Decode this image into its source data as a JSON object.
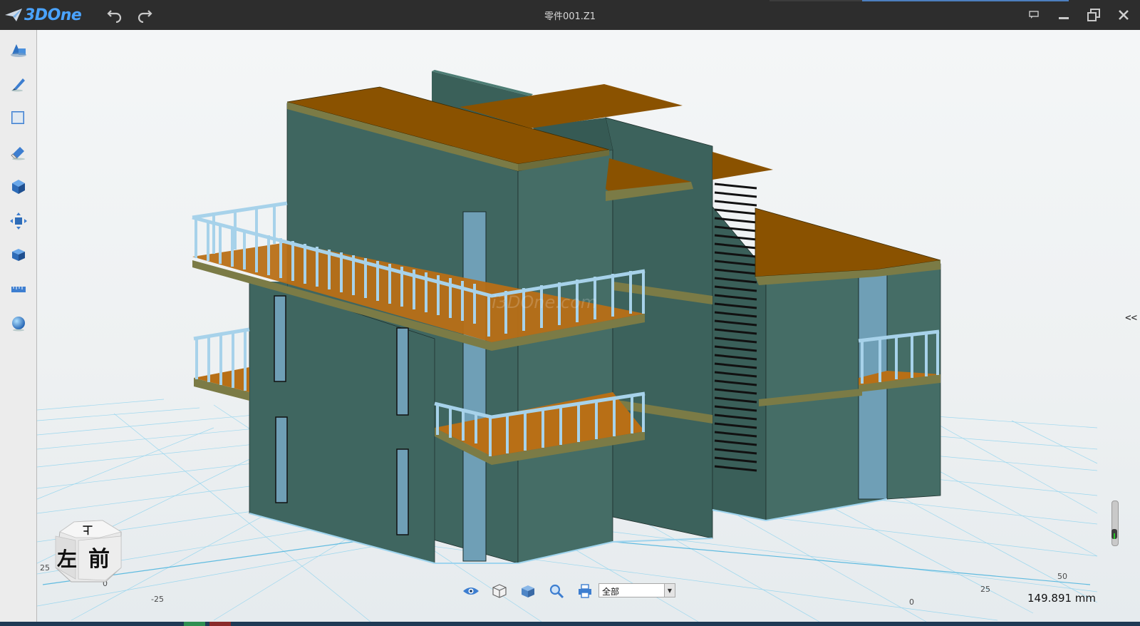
{
  "app": {
    "name": "3DOne",
    "document_title": "零件001.Z1",
    "brand_color": "#4aa3ff"
  },
  "title_bar": {
    "undo_icon": "undo-icon",
    "redo_icon": "redo-icon",
    "window_buttons": [
      "comment-icon",
      "minimize-icon",
      "restore-icon",
      "close-icon"
    ]
  },
  "left_toolbar": {
    "tools": [
      {
        "name": "basic-solids",
        "icon": "solids-icon"
      },
      {
        "name": "sketch",
        "icon": "pen-icon"
      },
      {
        "name": "sketch-edit",
        "icon": "rectangle-icon"
      },
      {
        "name": "special-features",
        "icon": "eraser-icon"
      },
      {
        "name": "feature-modeling",
        "icon": "cube-icon"
      },
      {
        "name": "basic-edit",
        "icon": "move-arrows-icon"
      },
      {
        "name": "combine",
        "icon": "stacked-box-icon"
      },
      {
        "name": "measure",
        "icon": "ruler-icon"
      },
      {
        "name": "render",
        "icon": "sphere-icon"
      }
    ]
  },
  "viewport": {
    "watermark": "i3DOne.com",
    "collapse_label": "<<",
    "distance_readout": "149.891 mm",
    "grid_labels": {
      "left_25": "25",
      "left_0": "0",
      "left_neg25": "-25",
      "right_50": "50",
      "right_25": "25",
      "right_0": "0"
    },
    "view_cube": {
      "top": "上",
      "left": "左",
      "front": "前"
    },
    "colors": {
      "wall": "#3f6660",
      "roof": "#8a5200",
      "trim": "#7b7b46",
      "railing": "#a7d2ea",
      "glass": "#7da9c2",
      "grid": "#7dcbe8"
    }
  },
  "bottom_toolbar": {
    "buttons": [
      "eye-icon",
      "wire-cube-icon",
      "shaded-cube-icon",
      "zoom-icon",
      "print-icon"
    ],
    "filter_value": "全部"
  }
}
